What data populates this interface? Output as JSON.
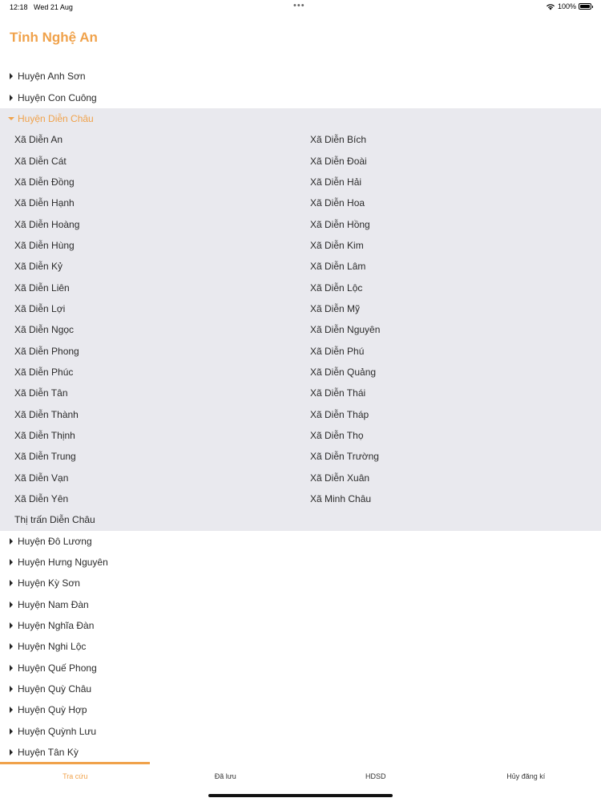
{
  "status": {
    "time": "12:18",
    "date": "Wed 21 Aug",
    "dots": "•••",
    "battery_text": "100%",
    "battery_level": 1.0
  },
  "title": "Tỉnh Nghệ An",
  "districts_before": [
    "Huyện Anh Sơn",
    "Huyện Con Cuông"
  ],
  "expanded": {
    "name": "Huyện Diễn Châu",
    "communes": [
      "Xã Diễn An",
      "Xã Diễn Bích",
      "Xã Diễn Cát",
      "Xã Diễn Đoài",
      "Xã Diễn Đồng",
      "Xã Diễn Hải",
      "Xã Diễn Hạnh",
      "Xã Diễn Hoa",
      "Xã Diễn Hoàng",
      "Xã Diễn Hồng",
      "Xã Diễn Hùng",
      "Xã Diễn Kim",
      "Xã Diễn Kỷ",
      "Xã Diễn Lâm",
      "Xã Diễn Liên",
      "Xã Diễn Lộc",
      "Xã Diễn Lợi",
      "Xã Diễn Mỹ",
      "Xã Diễn Ngọc",
      "Xã Diễn Nguyên",
      "Xã Diễn Phong",
      "Xã Diễn Phú",
      "Xã Diễn Phúc",
      "Xã Diễn Quảng",
      "Xã Diễn Tân",
      "Xã Diễn Thái",
      "Xã Diễn Thành",
      "Xã Diễn Tháp",
      "Xã Diễn Thịnh",
      "Xã Diễn Thọ",
      "Xã Diễn Trung",
      "Xã Diễn Trường",
      "Xã Diễn Vạn",
      "Xã Diễn Xuân",
      "Xã Diễn Yên",
      "Xã Minh Châu",
      "Thị trấn Diễn Châu"
    ]
  },
  "districts_after": [
    "Huyện Đô Lương",
    "Huyện Hưng Nguyên",
    "Huyện Kỳ Sơn",
    "Huyện Nam Đàn",
    "Huyện Nghĩa Đàn",
    "Huyện Nghi Lộc",
    "Huyện Quế Phong",
    "Huyện Quỳ Châu",
    "Huyện Quỳ Hợp",
    "Huyện Quỳnh Lưu",
    "Huyện Tân Kỳ"
  ],
  "tabs": [
    "Tra cứu",
    "Đã lưu",
    "HDSD",
    "Hủy đăng kí"
  ],
  "active_tab": 0,
  "colors": {
    "accent": "#f0a24b",
    "expanded_bg": "#e9e9ee",
    "text": "#2b2b2b"
  }
}
